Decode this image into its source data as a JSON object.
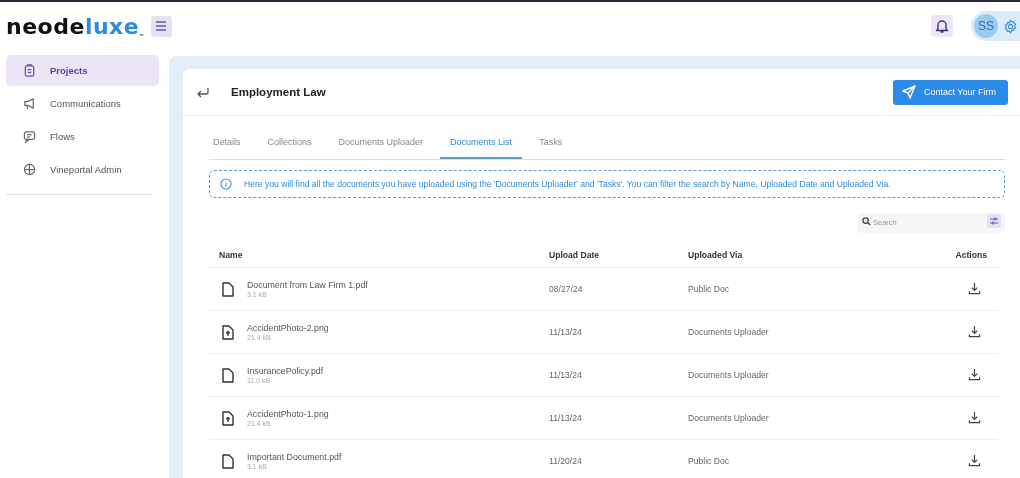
{
  "header": {
    "logo": {
      "main": "neode",
      "accent": "luxe",
      "mark": "™"
    },
    "avatar": "SS"
  },
  "sidebar": {
    "items": [
      {
        "label": "Projects",
        "kind": "clipboard",
        "selected": true
      },
      {
        "label": "Communications",
        "kind": "megaphone",
        "selected": false
      },
      {
        "label": "Flows",
        "kind": "message",
        "selected": false
      },
      {
        "label": "Vineportal Admin",
        "kind": "globe",
        "selected": false
      }
    ]
  },
  "page": {
    "title": "Employment Law",
    "contact_button": "Contact Your Firm",
    "tabs": [
      {
        "label": "Details",
        "selected": false
      },
      {
        "label": "Collections",
        "selected": false
      },
      {
        "label": "Documents Uploader",
        "selected": false
      },
      {
        "label": "Documents List",
        "selected": true
      },
      {
        "label": "Tasks",
        "selected": false
      }
    ],
    "info": "Here you will find all the documents you have uploaded using the 'Documents Uploader' and 'Tasks'. You can filter the search by Name, Uploaded Date and Uploaded Via.",
    "search": {
      "placeholder": "Search"
    },
    "table": {
      "columns": [
        "Name",
        "Upload Date",
        "Uploaded Via",
        "Actions"
      ],
      "rows": [
        {
          "kind": "document",
          "name": "Document from Law Firm 1.pdf",
          "size": "3.1 kB",
          "date": "08/27/24",
          "via": "Public Doc"
        },
        {
          "kind": "image",
          "name": "AccidentPhoto-2.png",
          "size": "21.4 kB",
          "date": "11/13/24",
          "via": "Documents Uploader"
        },
        {
          "kind": "document",
          "name": "InsurancePolicy.pdf",
          "size": "11.0 kB",
          "date": "11/13/24",
          "via": "Documents Uploader"
        },
        {
          "kind": "image",
          "name": "AccidentPhoto-1.png",
          "size": "21.4 kB",
          "date": "11/13/24",
          "via": "Documents Uploader"
        },
        {
          "kind": "document",
          "name": "Important Document.pdf",
          "size": "3.1 kB",
          "date": "11/20/24",
          "via": "Public Doc"
        }
      ]
    }
  }
}
